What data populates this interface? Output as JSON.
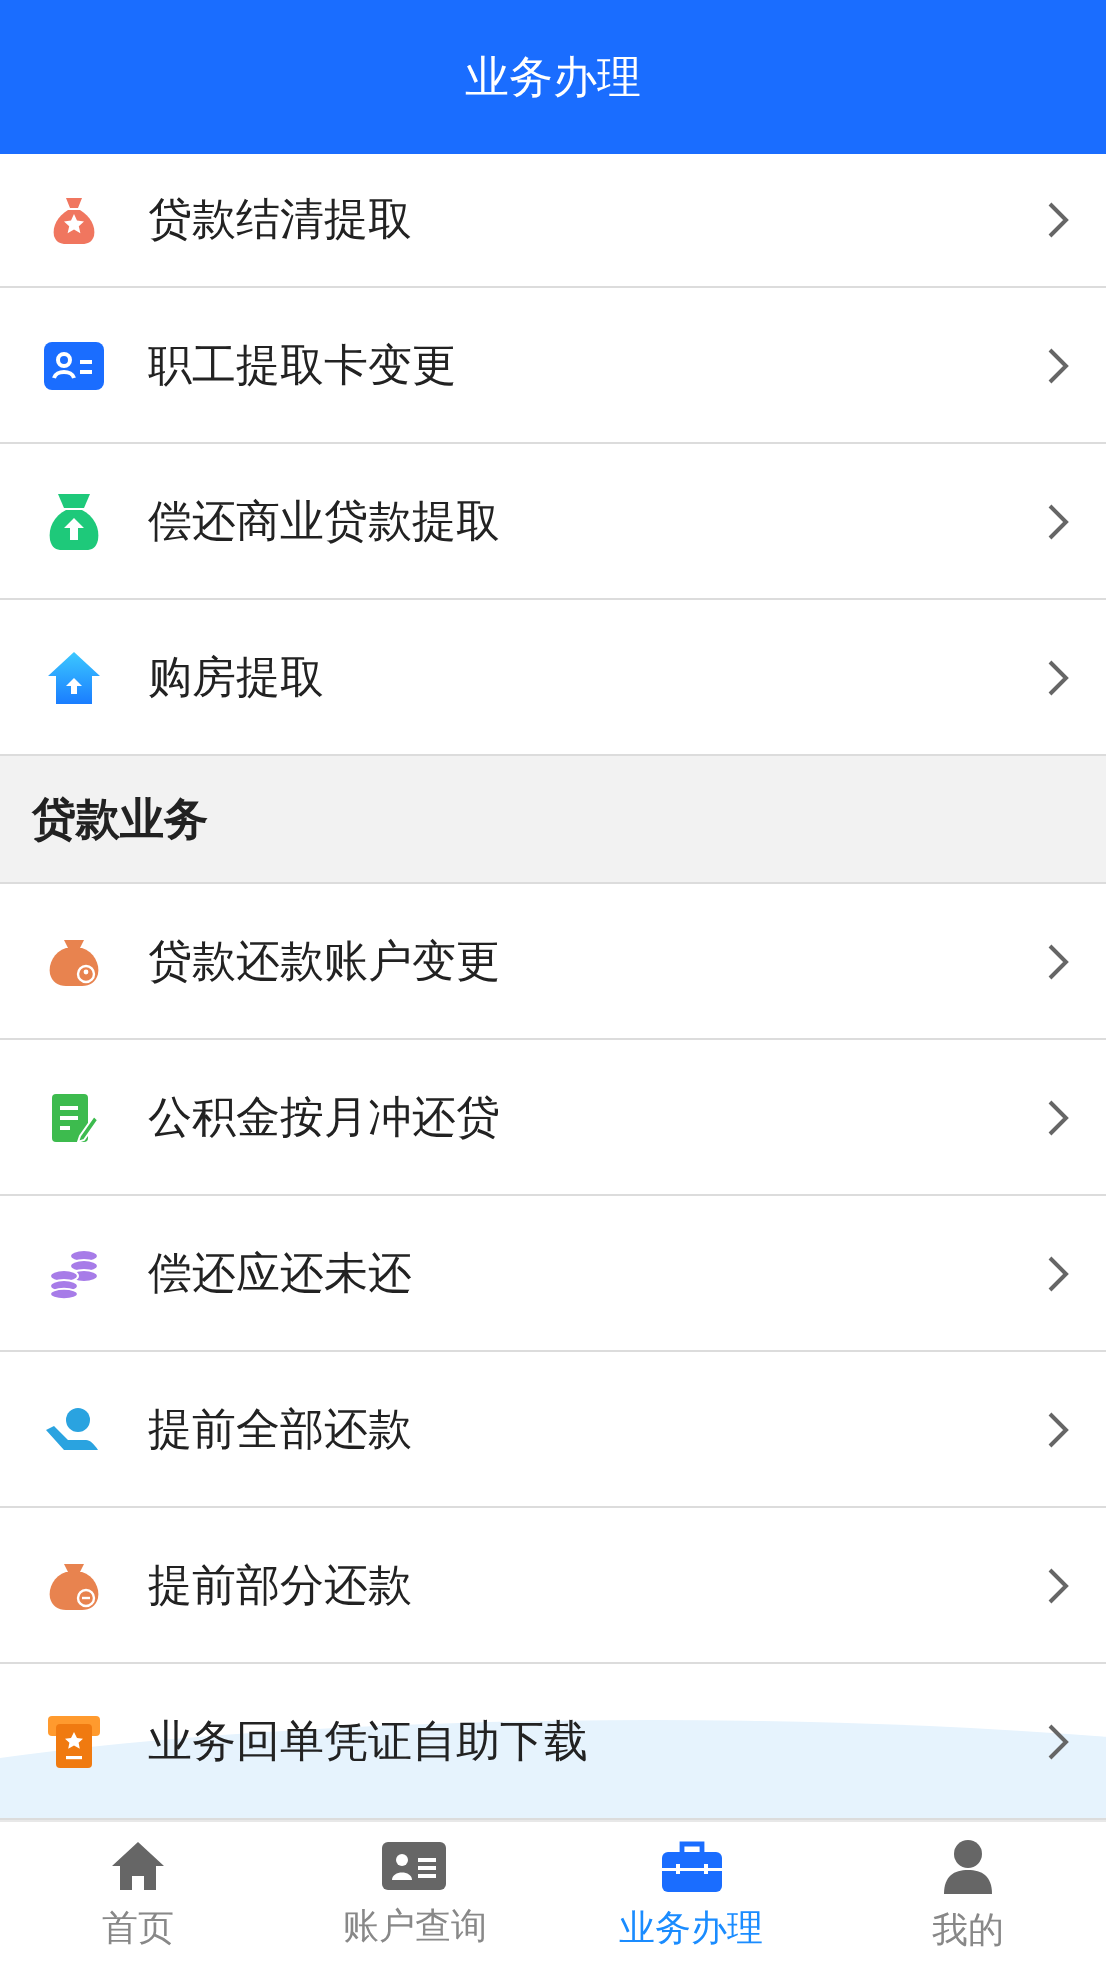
{
  "header": {
    "title": "业务办理"
  },
  "sections": [
    {
      "items": [
        {
          "label": "贷款结清提取",
          "kind": "bagstar"
        },
        {
          "label": "职工提取卡变更",
          "kind": "card"
        },
        {
          "label": "偿还商业贷款提取",
          "kind": "bagup"
        },
        {
          "label": "购房提取",
          "kind": "house"
        }
      ]
    },
    {
      "title": "贷款业务",
      "items": [
        {
          "label": "贷款还款账户变更",
          "kind": "bagperson"
        },
        {
          "label": "公积金按月冲还贷",
          "kind": "document"
        },
        {
          "label": "偿还应还未还",
          "kind": "coins"
        },
        {
          "label": "提前全部还款",
          "kind": "hand"
        },
        {
          "label": "提前部分还款",
          "kind": "bagminus"
        },
        {
          "label": "业务回单凭证自助下载",
          "kind": "ticket"
        }
      ]
    }
  ],
  "tabs": [
    {
      "label": "首页",
      "kind": "home",
      "selected": false
    },
    {
      "label": "账户查询",
      "kind": "card",
      "selected": false
    },
    {
      "label": "业务办理",
      "kind": "briefcase",
      "selected": true
    },
    {
      "label": "我的",
      "kind": "person",
      "selected": false
    }
  ]
}
